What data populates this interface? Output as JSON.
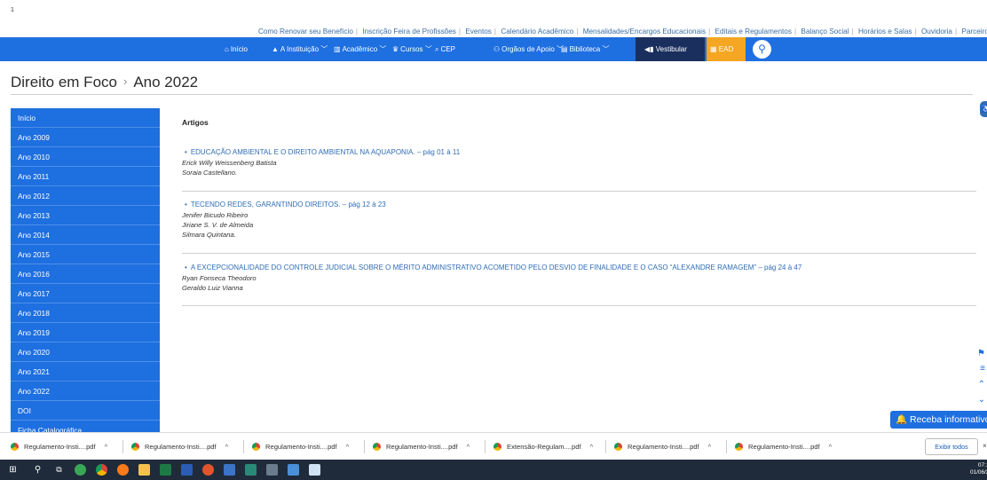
{
  "page_marker": "1",
  "top_links": [
    "Como Renovar seu Benefício",
    "Inscrição Feira de Profissões",
    "Eventos",
    "Calendário Acadêmico",
    "Mensalidades/Encargos Educacionais",
    "Editais e Regulamentos",
    "Balanço Social",
    "Horários e Salas",
    "Ouvidoria",
    "Parceiros"
  ],
  "nav": {
    "items": [
      {
        "icon": "⌂",
        "label": "Início"
      },
      {
        "icon": "▲",
        "label": "A Instituição ﹀"
      },
      {
        "icon": "▥",
        "label": "Acadêmico ﹀"
      },
      {
        "icon": "♛",
        "label": "Cursos ﹀"
      },
      {
        "icon": "⌕",
        "label": "CEP"
      },
      {
        "icon": "⚇",
        "label": "Orgãos de Apoio ﹀"
      },
      {
        "icon": "▤",
        "label": "Biblioteca ﹀"
      }
    ],
    "vestibular": "◀▮ Vestibular",
    "ead": "▦ EAD",
    "search_icon": "⚲"
  },
  "breadcrumb": {
    "parent": "Direito em Foco",
    "separator": "›",
    "current": "Ano 2022"
  },
  "sidebar": [
    "Início",
    "Ano 2009",
    "Ano 2010",
    "Ano 2011",
    "Ano 2012",
    "Ano 2013",
    "Ano 2014",
    "Ano 2015",
    "Ano 2016",
    "Ano 2017",
    "Ano 2018",
    "Ano 2019",
    "Ano 2020",
    "Ano 2021",
    "Ano 2022",
    "DOI",
    "Ficha Catalográfica"
  ],
  "content": {
    "heading": "Artigos",
    "articles": [
      {
        "title": "EDUCAÇÃO AMBIENTAL E O DIREITO AMBIENTAL NA AQUAPONIA. – pág 01 à 11",
        "authors": [
          "Erick Willy Weissenberg Batista",
          "Soraia Castellano."
        ]
      },
      {
        "title": "TECENDO REDES, GARANTINDO DIREITOS. – pág 12 à 23",
        "authors": [
          "Jenifer Bicudo Ribeiro",
          "Jiriane S. V. de Almeida",
          "Silmara Quintana."
        ]
      },
      {
        "title": "A EXCEPCIONALIDADE DO CONTROLE JUDICIAL SOBRE O MÉRITO ADMINISTRATIVO ACOMETIDO PELO DESVIO DE FINALIDADE E O CASO “ALEXANDRE RAMAGEM” – pág 24 à 47",
        "authors": [
          "Ryan Fonseca Theodoro",
          "Geraldo Luiz Vianna"
        ]
      }
    ]
  },
  "receba": "🔔 Receba informativos",
  "downloads": {
    "files": [
      "Regulamento-Insti....pdf",
      "Regulamento-Insti....pdf",
      "Regulamento-Insti....pdf",
      "Regulamento-Insti....pdf",
      "Extensão-Regulam....pdf",
      "Regulamento-Insti....pdf",
      "Regulamento-Insti....pdf"
    ],
    "caret": "^",
    "show_all": "Exibir todos",
    "close": "×"
  },
  "taskbar": {
    "time": "07:17",
    "date": "01/06/20"
  },
  "colors": {
    "nav_blue": "#1e6fe0",
    "vestibular": "#1a2f5e",
    "ead": "#f5a623",
    "link": "#2f6db5"
  }
}
